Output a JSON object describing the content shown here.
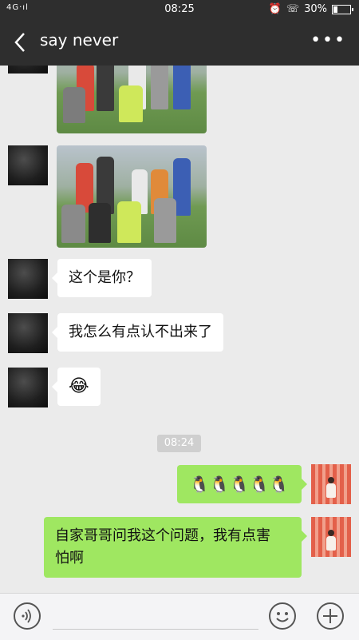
{
  "status_bar": {
    "network": "4G·ıl",
    "time": "08:25",
    "battery_percent_text": "30%",
    "battery_level": 0.3,
    "icons": [
      "signal-icon",
      "no-disturb-icon",
      "alarm-icon",
      "call-icon",
      "battery-icon"
    ]
  },
  "header": {
    "title": "say never",
    "back_icon": "chevron-left-icon",
    "more_label": "•••"
  },
  "messages": [
    {
      "side": "in",
      "type": "image",
      "desc": "group-photo"
    },
    {
      "side": "in",
      "type": "image",
      "desc": "group-photo"
    },
    {
      "side": "in",
      "type": "text",
      "text": "这个是你？"
    },
    {
      "side": "in",
      "type": "text",
      "text": "我怎么有点认不出来了"
    },
    {
      "side": "in",
      "type": "text",
      "text": "😂"
    },
    {
      "side": "out",
      "type": "text",
      "text": "🐧🐧🐧🐧🐧"
    },
    {
      "side": "out",
      "type": "text",
      "text_line1": "自家哥哥问我这个问题，我有点害",
      "text_line2": "怕啊"
    }
  ],
  "timestamp": "08:24",
  "colors": {
    "header_bg": "#2e2e2e",
    "chat_bg": "#ebebeb",
    "bubble_out": "#9fe761",
    "bubble_in": "#ffffff"
  },
  "input_bar": {
    "voice_icon": "voice-icon",
    "emoji_icon": "emoji-icon",
    "plus_icon": "plus-icon"
  }
}
